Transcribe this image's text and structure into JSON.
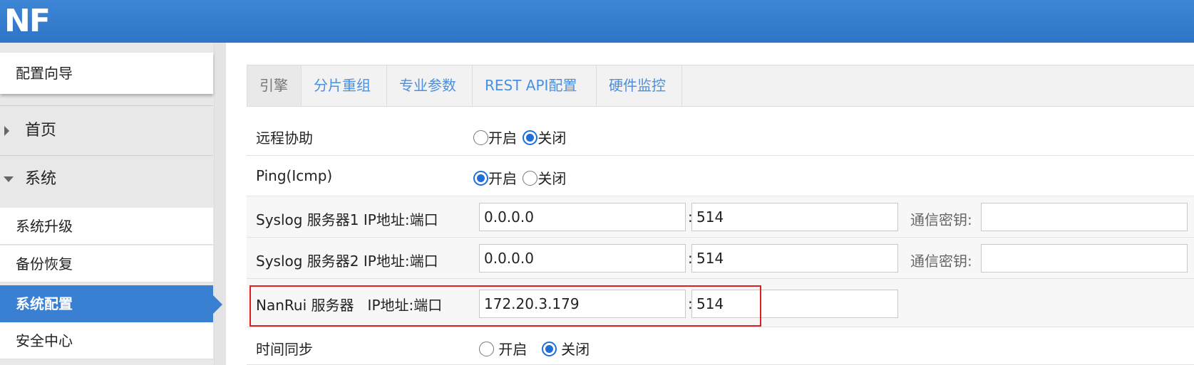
{
  "header": {
    "logo": "NF",
    "brand_color": "#3a80d2"
  },
  "sidebar": {
    "wizard": "配置向导",
    "sections": [
      {
        "label": "首页",
        "expanded": false
      },
      {
        "label": "系统",
        "expanded": true
      }
    ],
    "items": [
      {
        "label": "系统升级",
        "active": false
      },
      {
        "label": "备份恢复",
        "active": false
      },
      {
        "label": "系统配置",
        "active": true
      },
      {
        "label": "安全中心",
        "active": false
      }
    ]
  },
  "tabs": [
    {
      "label": "引擎",
      "active": true
    },
    {
      "label": "分片重组",
      "active": false
    },
    {
      "label": "专业参数",
      "active": false
    },
    {
      "label": "REST API配置",
      "active": false
    },
    {
      "label": "硬件监控",
      "active": false
    }
  ],
  "settings": {
    "remote_assist": {
      "label": "远程协助",
      "on_label": "开启",
      "off_label": "关闭",
      "value": "关闭"
    },
    "ping": {
      "label": "Ping(Icmp)",
      "on_label": "开启",
      "off_label": "关闭",
      "value": "开启"
    },
    "syslog1": {
      "label": "Syslog 服务器1 IP地址:端口",
      "ip": "0.0.0.0",
      "port": "514",
      "key_label": "通信密钥:",
      "key": ""
    },
    "syslog2": {
      "label": "Syslog 服务器2 IP地址:端口",
      "ip": "0.0.0.0",
      "port": "514",
      "key_label": "通信密钥:",
      "key": ""
    },
    "nanrui": {
      "label": "NanRui 服务器   IP地址:端口",
      "ip": "172.20.3.179",
      "port": "514"
    },
    "time_sync": {
      "label": "时间同步",
      "on_label": "开启",
      "off_label": "关闭",
      "value": "关闭"
    }
  },
  "separator": ":"
}
